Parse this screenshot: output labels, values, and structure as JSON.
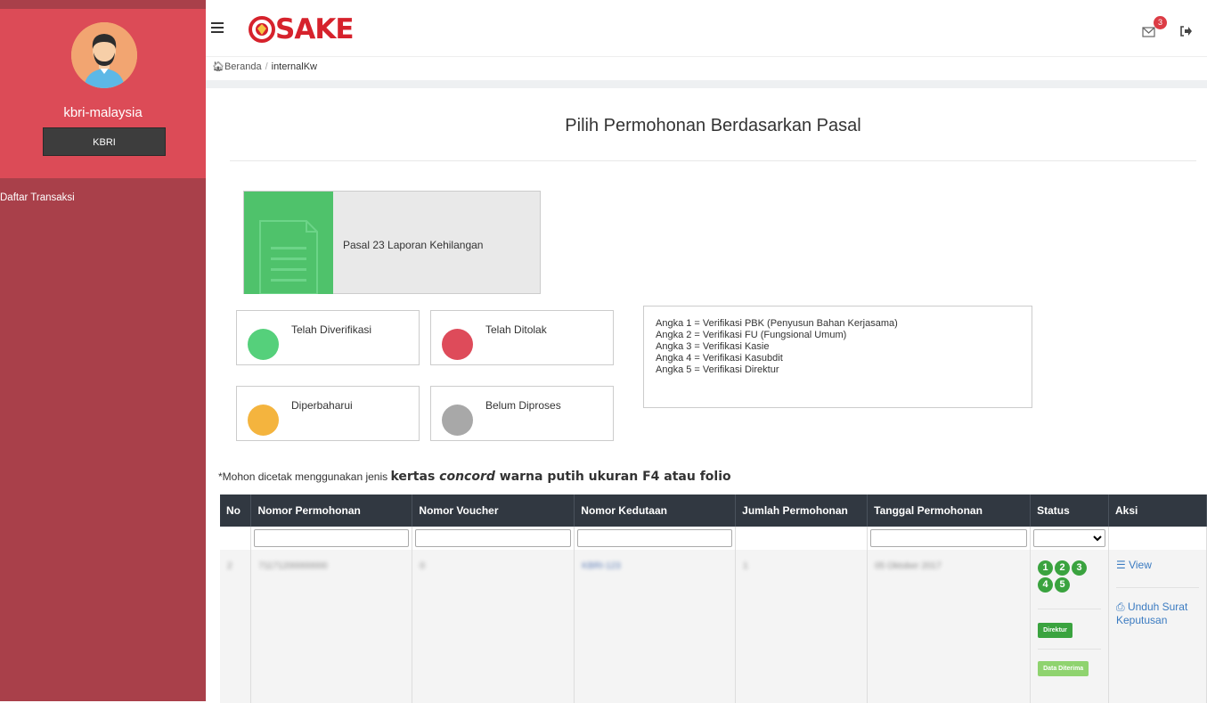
{
  "sidebar": {
    "username": "kbri-malaysia",
    "role": "KBRI",
    "menu": [
      {
        "label": "Daftar Transaksi"
      }
    ]
  },
  "header": {
    "logo_text": "SAKE",
    "mail_badge_count": "3"
  },
  "breadcrumb": {
    "home": "Beranda",
    "current": "internalKw"
  },
  "page": {
    "title": "Pilih Permohonan Berdasarkan Pasal"
  },
  "pasal_cards": [
    {
      "label": "Pasal 23 Laporan Kehilangan"
    }
  ],
  "legend": [
    {
      "label": "Telah Diverifikasi",
      "color": "#55d07b"
    },
    {
      "label": "Telah Ditolak",
      "color": "#de4b5a"
    },
    {
      "label": "Diperbaharui",
      "color": "#f4b43e"
    },
    {
      "label": "Belum Diproses",
      "color": "#a8a8a8"
    }
  ],
  "info_lines": [
    "Angka 1 = Verifikasi PBK (Penyusun Bahan Kerjasama)",
    "Angka 2 = Verifikasi FU (Fungsional Umum)",
    "Angka 3 = Verifikasi Kasie",
    "Angka 4 = Verifikasi Kasubdit",
    "Angka 5 = Verifikasi Direktur"
  ],
  "note": {
    "prefix": "*Mohon dicetak menggunakan jenis ",
    "bold_1": "kertas ",
    "italic": "concord",
    "bold_2": " warna putih ukuran F4 atau folio"
  },
  "table": {
    "headers": [
      "No",
      "Nomor Permohonan",
      "Nomor Voucher",
      "Nomor Kedutaan",
      "Jumlah Permohonan",
      "Tanggal Permohonan",
      "Status",
      "Aksi"
    ],
    "rows": [
      {
        "no": "2",
        "nomor_permohonan": "71171200000000",
        "nomor_voucher": "0",
        "nomor_kedutaan": "KBRI-123",
        "jumlah": "1",
        "tanggal": "05 Oktober 2017",
        "steps": [
          "1",
          "2",
          "3",
          "4",
          "5"
        ],
        "step_color": "#3aa33f",
        "tag_primary": "Direktur",
        "tag_primary_color": "#3aa33f",
        "tag_secondary": "Data Diterima",
        "tag_secondary_color": "#8fd36f",
        "action_view": "View",
        "action_download": "Unduh Surat Keputusan"
      }
    ]
  }
}
